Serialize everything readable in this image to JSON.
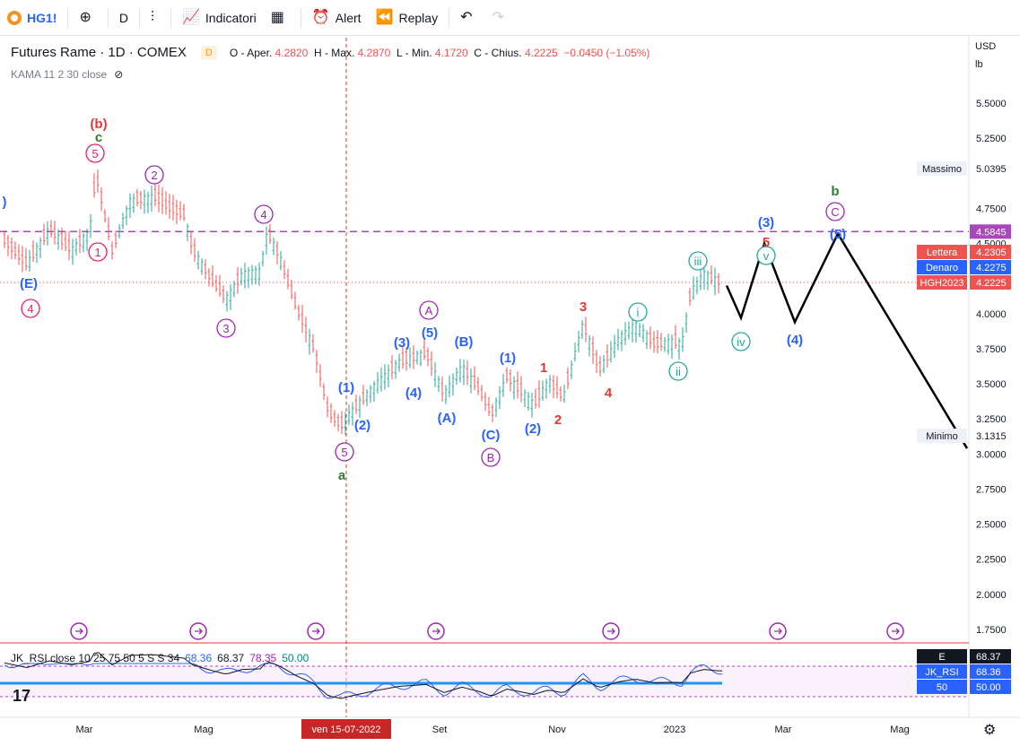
{
  "toolbar": {
    "symbol": "HG1!",
    "interval": "D",
    "indicators": "Indicatori",
    "alert": "Alert",
    "replay": "Replay",
    "plus_icon": "plus-circle-icon",
    "compare_icon": "bars-compare-icon",
    "indicators_icon": "function-icon",
    "layout_icon": "grid-icon",
    "alert_icon": "alarm-clock-icon",
    "replay_icon": "rewind-icon",
    "undo_icon": "undo-icon",
    "redo_icon": "redo-icon"
  },
  "legend": {
    "title": "Futures Rame · 1D · COMEX",
    "d_badge": "D",
    "open_label": "O - Aper.",
    "open": "4.2820",
    "high_label": "H - Max.",
    "high": "4.2870",
    "low_label": "L - Min.",
    "low": "4.1720",
    "close_label": "C - Chius.",
    "close": "4.2225",
    "change": "−0.0450 (−1.05%)",
    "indicator": "KAMA 11 2 30 close"
  },
  "rsi_legend": {
    "name": "JK_RSI close 10 25 75 50 5 S S 34",
    "v1": "68.36",
    "v2": "68.37",
    "v3": "78.35",
    "v4": "50.00"
  },
  "axis": {
    "currency": "USD",
    "unit": "lb",
    "ticks": [
      "5.5000",
      "5.2500",
      "4.7500",
      "4.5000",
      "4.0000",
      "3.7500",
      "3.5000",
      "3.2500",
      "3.0000",
      "2.7500",
      "2.5000",
      "2.2500",
      "2.0000",
      "1.7500"
    ],
    "time_ticks": [
      "Mar",
      "Mag",
      "Set",
      "Nov",
      "2023",
      "Mar",
      "Mag"
    ],
    "crosshair_date": "ven 15-07-2022"
  },
  "price_labels": {
    "massimo_label": "Massimo",
    "massimo": "5.0395",
    "dashed": "4.5845",
    "lettera_label": "Lettera",
    "lettera": "4.2305",
    "denaro_label": "Denaro",
    "denaro": "4.2275",
    "contract_label": "HGH2023",
    "contract": "4.2225",
    "minimo_label": "Minimo",
    "minimo": "3.1315",
    "rsi_e_label": "E",
    "rsi_e": "68.37",
    "rsi_label": "JK_RSI",
    "rsi": "68.36",
    "rsi_mid_label": "50",
    "rsi_mid": "50.00"
  },
  "waves": [
    {
      "t": "(b)",
      "c": "#e53935",
      "circle": false
    },
    {
      "t": "c",
      "c": "#2e7d32",
      "circle": false
    },
    {
      "t": "5",
      "c": "#e91e63",
      "circle": true
    },
    {
      "t": "2",
      "c": "#9c27b0",
      "circle": true
    },
    {
      "t": "4",
      "c": "#9c27b0",
      "circle": true
    },
    {
      "t": "1",
      "c": "#e91e63",
      "circle": true
    },
    {
      "t": "(E)",
      "c": "#2962ff",
      "circle": false
    },
    {
      "t": "4",
      "c": "#e91e63",
      "circle": true
    },
    {
      "t": "3",
      "c": "#9c27b0",
      "circle": true
    },
    {
      "t": "(1)",
      "c": "#2962ff",
      "circle": false
    },
    {
      "t": "(2)",
      "c": "#2962ff",
      "circle": false
    },
    {
      "t": "5",
      "c": "#9c27b0",
      "circle": true
    },
    {
      "t": "a",
      "c": "#2e7d32",
      "circle": false
    },
    {
      "t": "(3)",
      "c": "#2962ff",
      "circle": false
    },
    {
      "t": "(4)",
      "c": "#2962ff",
      "circle": false
    },
    {
      "t": "A",
      "c": "#9c27b0",
      "circle": true
    },
    {
      "t": "(5)",
      "c": "#2962ff",
      "circle": false
    },
    {
      "t": "(B)",
      "c": "#2962ff",
      "circle": false
    },
    {
      "t": "(A)",
      "c": "#2962ff",
      "circle": false
    },
    {
      "t": "(C)",
      "c": "#2962ff",
      "circle": false
    },
    {
      "t": "B",
      "c": "#9c27b0",
      "circle": true
    },
    {
      "t": "(1)",
      "c": "#2962ff",
      "circle": false
    },
    {
      "t": "(2)",
      "c": "#2962ff",
      "circle": false
    },
    {
      "t": "1",
      "c": "#e53935",
      "circle": false
    },
    {
      "t": "2",
      "c": "#e53935",
      "circle": false
    },
    {
      "t": "3",
      "c": "#e53935",
      "circle": false
    },
    {
      "t": "4",
      "c": "#e53935",
      "circle": false
    },
    {
      "t": "i",
      "c": "#26a69a",
      "circle": true
    },
    {
      "t": "ii",
      "c": "#26a69a",
      "circle": true
    },
    {
      "t": "iii",
      "c": "#26a69a",
      "circle": true
    },
    {
      "t": "iv",
      "c": "#26a69a",
      "circle": true
    },
    {
      "t": "v",
      "c": "#26a69a",
      "circle": true
    },
    {
      "t": "5",
      "c": "#e53935",
      "circle": false
    },
    {
      "t": "(3)",
      "c": "#2962ff",
      "circle": false
    },
    {
      "t": "(4)",
      "c": "#2962ff",
      "circle": false
    },
    {
      "t": "(5)",
      "c": "#2962ff",
      "circle": false
    },
    {
      "t": "C",
      "c": "#9c27b0",
      "circle": true
    },
    {
      "t": "b",
      "c": "#2e7d32",
      "circle": false
    },
    {
      "t": ")",
      "c": "#2962ff",
      "circle": false
    }
  ],
  "chart_data": {
    "type": "candlestick",
    "y_range": [
      1.65,
      5.75
    ],
    "projection": [
      [
        4.2,
        3.97,
        4.5,
        3.94,
        4.57,
        3.04
      ]
    ],
    "colors": {
      "up": "#26a69a",
      "down": "#ef5350",
      "projection": "#000000",
      "dashed": "#ab47bc",
      "crosshair": "#e53935"
    }
  }
}
